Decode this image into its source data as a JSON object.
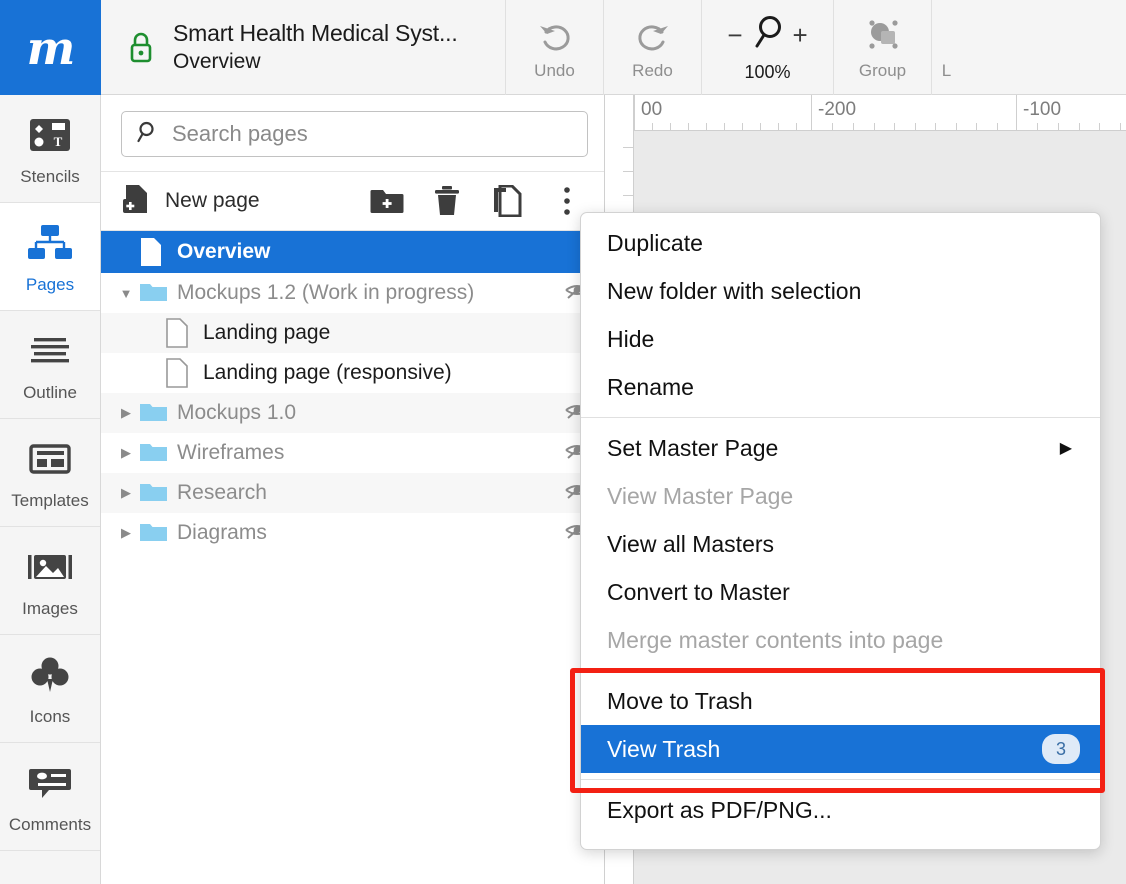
{
  "app": {
    "logo_letter": "m",
    "document_title": "Smart Health Medical Syst...",
    "document_subtitle": "Overview"
  },
  "toolbar": {
    "undo_label": "Undo",
    "redo_label": "Redo",
    "zoom_minus": "−",
    "zoom_plus": "+",
    "zoom_level": "100%",
    "group_label": "Group",
    "cut_off_label": "L"
  },
  "rail": {
    "items": [
      {
        "label": "Stencils",
        "icon": "stencils-icon",
        "active": false
      },
      {
        "label": "Pages",
        "icon": "pages-icon",
        "active": true
      },
      {
        "label": "Outline",
        "icon": "outline-icon",
        "active": false
      },
      {
        "label": "Templates",
        "icon": "templates-icon",
        "active": false
      },
      {
        "label": "Images",
        "icon": "images-icon",
        "active": false
      },
      {
        "label": "Icons",
        "icon": "icons-icon",
        "active": false
      },
      {
        "label": "Comments",
        "icon": "comments-icon",
        "active": false
      }
    ]
  },
  "panel": {
    "search_placeholder": "Search pages",
    "new_page_label": "New page",
    "toolbar_icons": [
      "new-folder-icon",
      "trash-icon",
      "duplicate-icon",
      "more-options-icon"
    ],
    "tree": [
      {
        "label": "Overview",
        "type": "page",
        "depth": 0,
        "selected": true,
        "hidden_eye": false,
        "expander": "none"
      },
      {
        "label": "Mockups 1.2 (Work in progress)",
        "type": "folder",
        "depth": 0,
        "selected": false,
        "hidden_eye": true,
        "expander": "down"
      },
      {
        "label": "Landing page",
        "type": "page",
        "depth": 1,
        "selected": false,
        "hidden_eye": false,
        "expander": "none"
      },
      {
        "label": "Landing page (responsive)",
        "type": "page",
        "depth": 1,
        "selected": false,
        "hidden_eye": false,
        "expander": "none"
      },
      {
        "label": "Mockups 1.0",
        "type": "folder",
        "depth": 0,
        "selected": false,
        "hidden_eye": true,
        "expander": "right"
      },
      {
        "label": "Wireframes",
        "type": "folder",
        "depth": 0,
        "selected": false,
        "hidden_eye": true,
        "expander": "right"
      },
      {
        "label": "Research",
        "type": "folder",
        "depth": 0,
        "selected": false,
        "hidden_eye": true,
        "expander": "right"
      },
      {
        "label": "Diagrams",
        "type": "folder",
        "depth": 0,
        "selected": false,
        "hidden_eye": true,
        "expander": "right"
      }
    ]
  },
  "canvas": {
    "ruler_labels": [
      "00",
      "-200",
      "-100"
    ]
  },
  "context_menu": {
    "items": [
      {
        "label": "Duplicate",
        "state": "normal"
      },
      {
        "label": "New folder with selection",
        "state": "normal"
      },
      {
        "label": "Hide",
        "state": "normal"
      },
      {
        "label": "Rename",
        "state": "normal"
      },
      {
        "label": "Set Master Page",
        "state": "normal",
        "submenu": "▶"
      },
      {
        "label": "View Master Page",
        "state": "disabled"
      },
      {
        "label": "View all Masters",
        "state": "normal"
      },
      {
        "label": "Convert to Master",
        "state": "normal"
      },
      {
        "label": "Merge master contents into page",
        "state": "disabled"
      },
      {
        "label": "Move to Trash",
        "state": "normal"
      },
      {
        "label": "View Trash",
        "state": "highlighted",
        "badge": "3"
      },
      {
        "label": "Export as PDF/PNG...",
        "state": "normal"
      }
    ]
  },
  "colors": {
    "accent_blue": "#1872d6",
    "highlight_red": "#f32013",
    "lock_green": "#1e8e2f",
    "folder_blue": "#89cff0"
  }
}
